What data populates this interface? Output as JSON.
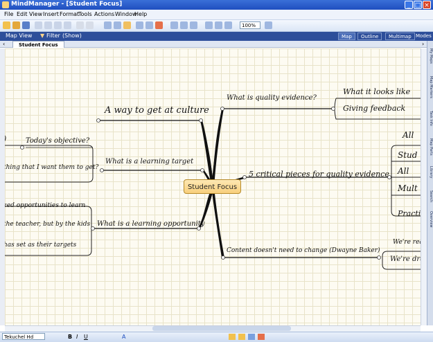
{
  "window": {
    "title": "MindManager - [Student Focus]"
  },
  "menu": [
    "File",
    "Edit",
    "View",
    "Insert",
    "Format",
    "Tools",
    "Actions",
    "Window",
    "Help"
  ],
  "toolbar": {
    "zoom": "100%"
  },
  "viewbar": {
    "view_label": "Map View",
    "filter_label": "Filter",
    "show_label": "(Show)",
    "tabs": [
      "Map",
      "Outline",
      "Multimap",
      "Modes"
    ]
  },
  "doc_tab": "Student Focus",
  "right_tabs": [
    "My Maps",
    "Map Markers",
    "Task Info",
    "Map Parts",
    "Library",
    "Search",
    "Overview"
  ],
  "map": {
    "central": "Student Focus",
    "topics": {
      "a_way": "A way to get at culture",
      "todays_objective": "Today's objective?",
      "thing_want": "thing that I want them to get?",
      "learning_target": "What is a learning target",
      "opportunities": "zed opportunities to learn",
      "teacher": "the teacher, but by the kids",
      "set_targets": "has set as their targets",
      "learning_opportunity": "What is a learning opportunity",
      "quality_evidence": "What is quality evidence?",
      "what_it_looks": "What it looks like",
      "giving_feedback": "Giving feedback",
      "five_pieces": "5 critical pieces for quality evidence",
      "all1": "All",
      "stud": "Stud",
      "all2": "All",
      "mult": "Mult",
      "practi": "Practi",
      "content": "Content doesn't need to change (Dwayne Baker)",
      "were_real": "We're real",
      "were_dra": "We're dra"
    }
  },
  "format": {
    "font": "Tekuchel Hd"
  }
}
